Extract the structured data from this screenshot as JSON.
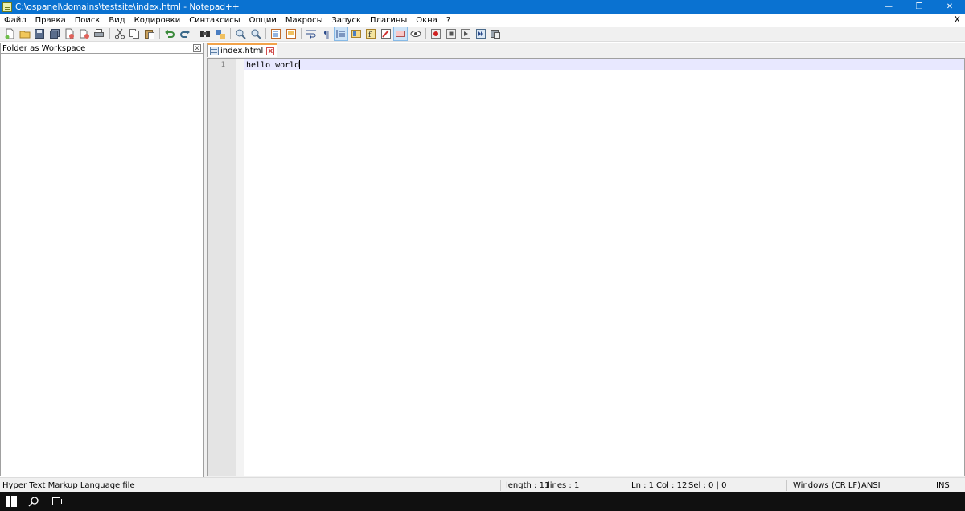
{
  "window": {
    "title": "C:\\ospanel\\domains\\testsite\\index.html - Notepad++",
    "minimize_glyph": "—",
    "restore_glyph": "❐",
    "close_glyph": "✕"
  },
  "menu": {
    "items": [
      "Файл",
      "Правка",
      "Поиск",
      "Вид",
      "Кодировки",
      "Синтаксисы",
      "Опции",
      "Макросы",
      "Запуск",
      "Плагины",
      "Окна",
      "?"
    ],
    "close_document": "X"
  },
  "toolbar": {
    "icons": [
      "new-file-icon",
      "open-file-icon",
      "save-icon",
      "save-all-icon",
      "close-icon",
      "close-all-icon",
      "print-icon",
      "cut-icon",
      "copy-icon",
      "paste-icon",
      "undo-icon",
      "redo-icon",
      "find-icon",
      "replace-icon",
      "zoom-in-icon",
      "zoom-out-icon",
      "sync-vertical-icon",
      "sync-horizontal-icon",
      "word-wrap-icon",
      "show-all-chars-icon",
      "indent-guide-icon",
      "document-map-icon",
      "function-list-icon",
      "folder-workspace-icon",
      "doc-switcher-icon",
      "monitoring-icon",
      "record-macro-icon",
      "stop-macro-icon",
      "play-macro-icon",
      "run-macro-multiple-icon",
      "save-macro-icon"
    ]
  },
  "left_panel": {
    "title": "Folder as Workspace",
    "close_glyph": "x"
  },
  "editor": {
    "tab": {
      "label": "index.html",
      "close_glyph": "x"
    },
    "lines": [
      {
        "number": "1",
        "text": "hello world"
      }
    ]
  },
  "statusbar": {
    "file_type": "Hyper Text Markup Language file",
    "length": "length : 11",
    "lines": "lines : 1",
    "ln": "Ln : 1",
    "col": "Col : 12",
    "sel": "Sel : 0 | 0",
    "eol": "Windows (CR LF)",
    "encoding": "ANSI",
    "mode": "INS"
  },
  "colors": {
    "titlebar": "#0a72d1",
    "current_line": "#e8e8ff",
    "tab_accent": "#f2a34b",
    "taskbar": "#101010"
  }
}
